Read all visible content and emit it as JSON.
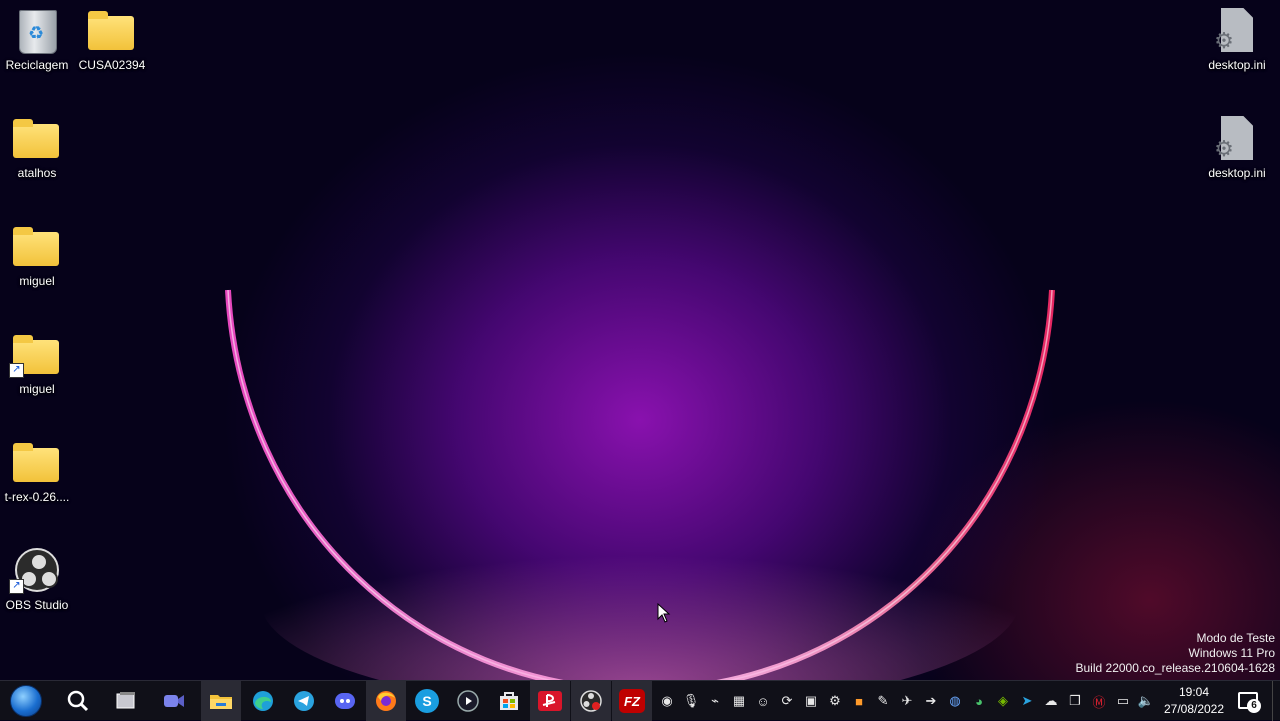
{
  "desktop": {
    "icons": [
      {
        "label": "Reciclagem",
        "kind": "recycle-bin"
      },
      {
        "label": "CUSA02394",
        "kind": "folder"
      },
      {
        "label": "atalhos",
        "kind": "folder"
      },
      {
        "label": "miguel",
        "kind": "folder"
      },
      {
        "label": "miguel",
        "kind": "folder-shortcut"
      },
      {
        "label": "t-rex-0.26....",
        "kind": "folder"
      },
      {
        "label": "OBS Studio",
        "kind": "app-shortcut"
      },
      {
        "label": "desktop.ini",
        "kind": "settings-file"
      },
      {
        "label": "desktop.ini",
        "kind": "settings-file"
      }
    ],
    "watermark": {
      "line1": "Modo de Teste",
      "line2": "Windows 11 Pro",
      "line3": "Build 22000.co_release.210604-1628"
    }
  },
  "taskbar": {
    "pinned": [
      {
        "name": "start-button",
        "icon": "windows-orb-icon"
      },
      {
        "name": "search-button",
        "icon": "search-icon"
      },
      {
        "name": "task-view-button",
        "icon": "task-view-icon"
      },
      {
        "name": "teams-chat-button",
        "icon": "video-chat-icon"
      },
      {
        "name": "file-explorer-button",
        "icon": "folder-icon"
      },
      {
        "name": "edge-button",
        "icon": "edge-icon"
      },
      {
        "name": "telegram-button",
        "icon": "telegram-icon"
      },
      {
        "name": "discord-button",
        "icon": "discord-icon"
      },
      {
        "name": "firefox-button",
        "icon": "firefox-icon"
      },
      {
        "name": "skype-button",
        "icon": "skype-icon",
        "glyph": "S"
      },
      {
        "name": "media-player-button",
        "icon": "play-icon"
      },
      {
        "name": "store-button",
        "icon": "store-icon"
      },
      {
        "name": "playstation-button",
        "icon": "playstation-icon"
      },
      {
        "name": "obs-button",
        "icon": "obs-icon"
      },
      {
        "name": "filezilla-button",
        "icon": "filezilla-icon",
        "glyph": "FZ"
      }
    ],
    "tray_icons": [
      "obs-tray-icon",
      "microphone-icon",
      "usb-icon",
      "app-tray-icon",
      "discord-tray-icon",
      "sync-icon",
      "teams-tray-icon",
      "steam-icon",
      "app-orange-icon",
      "feather-icon",
      "plane-icon",
      "arrow-circle-icon",
      "vpn-icon",
      "chrome-icon",
      "nvidia-icon",
      "telegram-tray-icon",
      "cloud-off-icon",
      "copy-icon",
      "mega-icon",
      "display-icon",
      "volume-icon"
    ],
    "clock": {
      "time": "19:04",
      "date": "27/08/2022"
    },
    "notifications": {
      "count": "6"
    }
  }
}
